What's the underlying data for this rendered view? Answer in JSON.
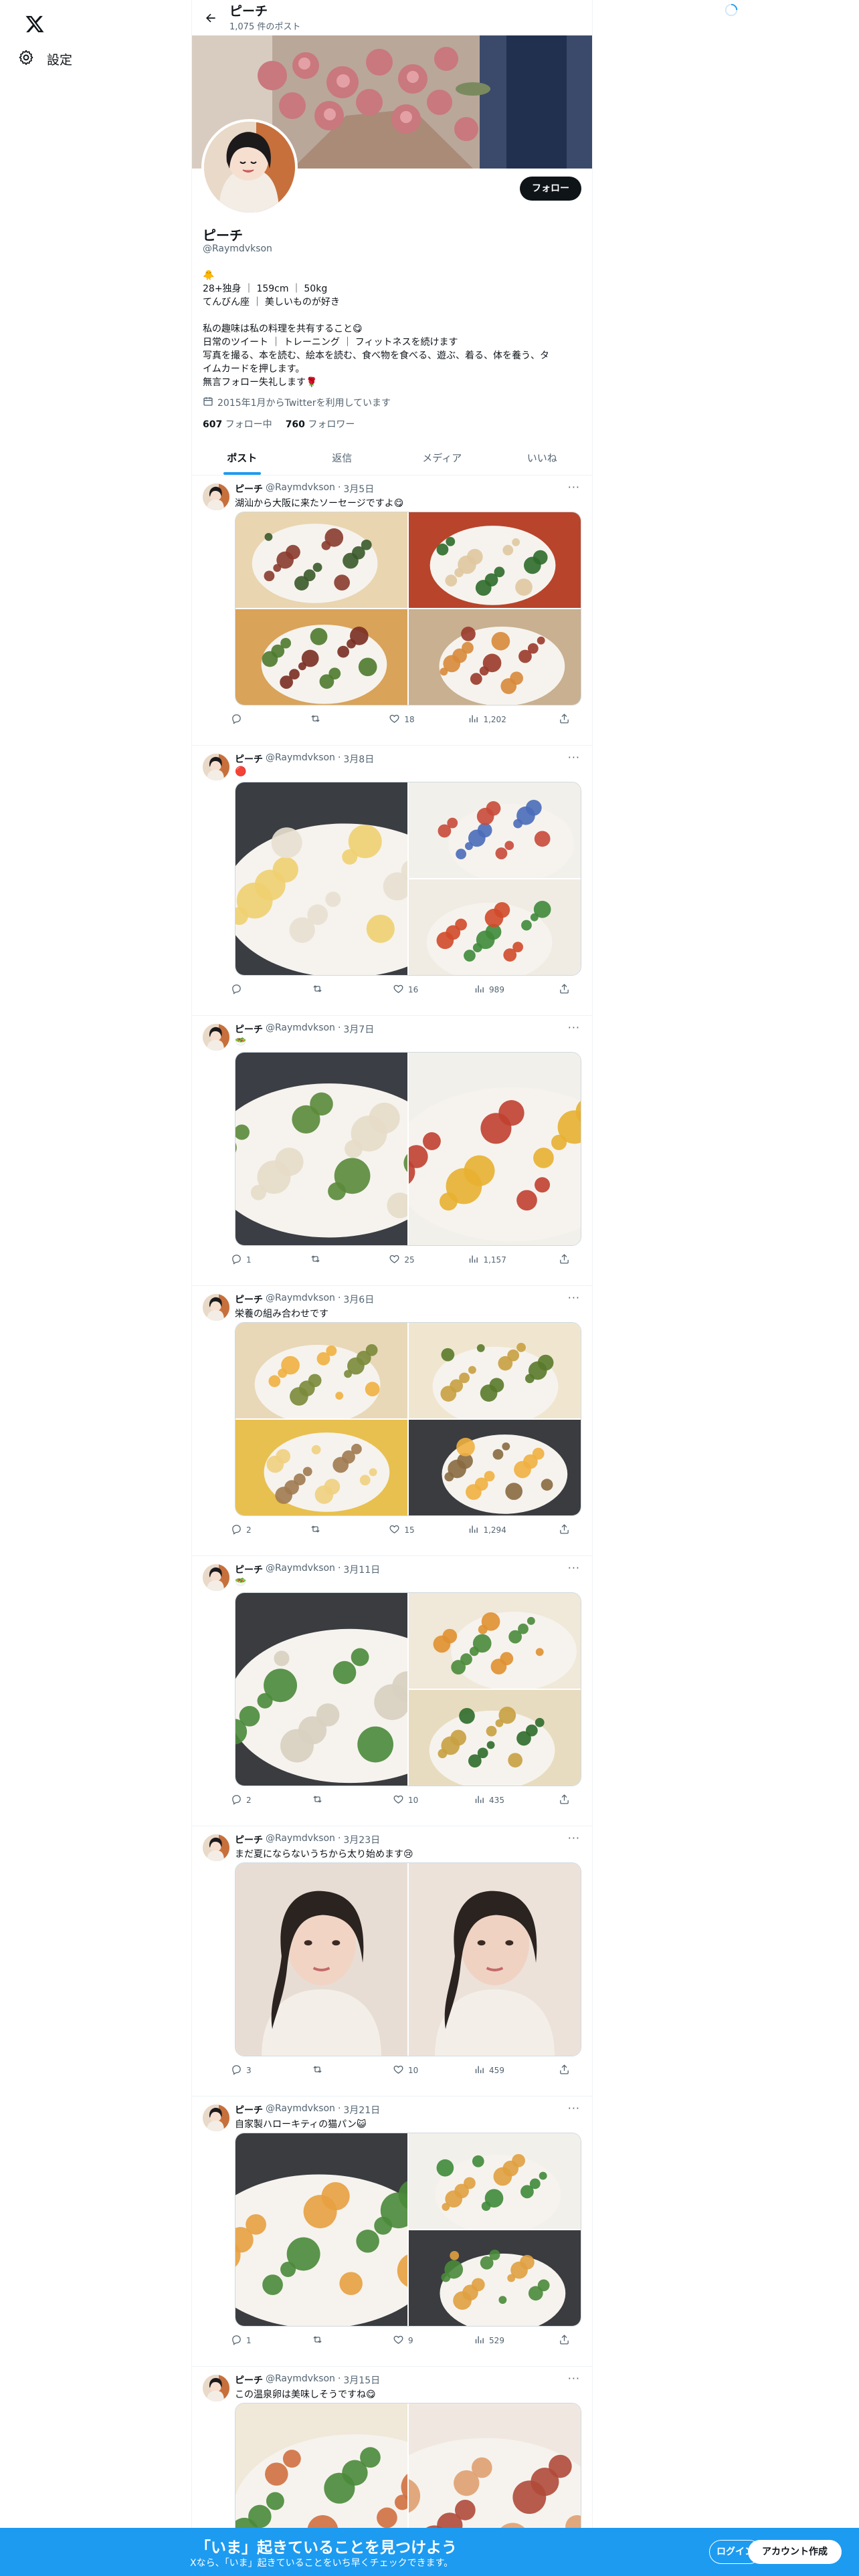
{
  "nav": {
    "settings_label": "設定"
  },
  "header": {
    "title": "ピーチ",
    "post_count": "1,075 件のポスト"
  },
  "profile": {
    "name": "ピーチ",
    "handle": "@Raymdvkson",
    "follow_label": "フォロー",
    "bio_lines": [
      "🐥",
      "28+独身 ｜ 159cm ｜ 50kg",
      "てんびん座 ｜ 美しいものが好き",
      "",
      "私の趣味は私の料理を共有すること😋",
      "日常のツイート ｜ トレーニング ｜ フィットネスを続けます",
      "写真を撮る、本を読む、絵本を読む、食べ物を食べる、遊ぶ、着る、体を養う、タ",
      "イムカードを押します。",
      "無言フォロー失礼します🌹"
    ],
    "joined": "2015年1月からTwitterを利用しています",
    "following_count": "607",
    "following_label": "フォロー中",
    "followers_count": "760",
    "followers_label": "フォロワー"
  },
  "tabs": [
    "ポスト",
    "返信",
    "メディア",
    "いいね"
  ],
  "tweets": [
    {
      "name": "ピーチ",
      "handle": "@Raymdvkson",
      "sep": "·",
      "date": "3月5日",
      "text": "湖汕から大阪に来たソーセージですよ😋",
      "replies": "",
      "retweets": "",
      "likes": "18",
      "views": "1,202"
    },
    {
      "name": "ピーチ",
      "handle": "@Raymdvkson",
      "sep": "·",
      "date": "3月8日",
      "text": "🔴",
      "replies": "",
      "retweets": "",
      "likes": "16",
      "views": "989"
    },
    {
      "name": "ピーチ",
      "handle": "@Raymdvkson",
      "sep": "·",
      "date": "3月7日",
      "text": "🥗",
      "replies": "1",
      "retweets": "",
      "likes": "25",
      "views": "1,157"
    },
    {
      "name": "ピーチ",
      "handle": "@Raymdvkson",
      "sep": "·",
      "date": "3月6日",
      "text": "栄養の組み合わせです",
      "replies": "2",
      "retweets": "",
      "likes": "15",
      "views": "1,294"
    },
    {
      "name": "ピーチ",
      "handle": "@Raymdvkson",
      "sep": "·",
      "date": "3月11日",
      "text": "🥗",
      "replies": "2",
      "retweets": "",
      "likes": "10",
      "views": "435"
    },
    {
      "name": "ピーチ",
      "handle": "@Raymdvkson",
      "sep": "·",
      "date": "3月23日",
      "text": "まだ夏にならないうちから太り始めます😢",
      "replies": "3",
      "retweets": "",
      "likes": "10",
      "views": "459"
    },
    {
      "name": "ピーチ",
      "handle": "@Raymdvkson",
      "sep": "·",
      "date": "3月21日",
      "text": "自家製ハローキティの猫パン😺",
      "replies": "1",
      "retweets": "",
      "likes": "9",
      "views": "529"
    },
    {
      "name": "ピーチ",
      "handle": "@Raymdvkson",
      "sep": "·",
      "date": "3月15日",
      "text": "この温泉卵は美味しそうですね😋",
      "replies": "",
      "retweets": "",
      "likes": "",
      "views": ""
    }
  ],
  "bottom_banner": {
    "headline": "「いま」起きていることを見つけよう",
    "subtext": "Xなら、「いま」起きていることをいち早くチェックできます。",
    "login_label": "ログイン",
    "signup_label": "アカウント作成"
  },
  "colors": {
    "accent": "#1d9bf0",
    "text": "#0f1419",
    "muted": "#536471",
    "border": "#eff3f4"
  }
}
